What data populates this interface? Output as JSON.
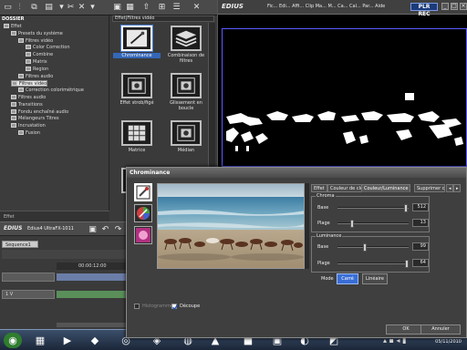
{
  "colors": {
    "accent": "#3467b8",
    "preview_border": "#5a5aff",
    "taskbar": "#1b2638"
  },
  "tree": {
    "header": "DOSSIER",
    "items": [
      {
        "label": "Effet",
        "level": 0
      },
      {
        "label": "Presets du système",
        "level": 1
      },
      {
        "label": "Filtres vidéo",
        "level": 2
      },
      {
        "label": "Color Correction",
        "level": 3
      },
      {
        "label": "Combine",
        "level": 3
      },
      {
        "label": "Matrix",
        "level": 3
      },
      {
        "label": "Region",
        "level": 3
      },
      {
        "label": "Filtres audio",
        "level": 2
      },
      {
        "label": "Filtres vidéo",
        "level": 1,
        "selected": true
      },
      {
        "label": "Correction colorimétrique",
        "level": 2
      },
      {
        "label": "Filtres audio",
        "level": 1
      },
      {
        "label": "Transitions",
        "level": 1
      },
      {
        "label": "Fondu enchaîné audio",
        "level": 1
      },
      {
        "label": "Mélangeurs Titres",
        "level": 1
      },
      {
        "label": "Incrustation",
        "level": 1
      },
      {
        "label": "Fusion",
        "level": 2
      }
    ],
    "footer": "Effet"
  },
  "palette": {
    "path": "Effet|Filtres vidéo",
    "items": [
      {
        "label": "Chrominance",
        "selected": true,
        "icon": "pen-icon"
      },
      {
        "label": "Combinaison de filtres",
        "icon": "stack-icon"
      },
      {
        "label": "Effet strob/figé",
        "icon": "film-icon"
      },
      {
        "label": "Glissement en boucle",
        "icon": "film-icon"
      },
      {
        "label": "Matrice",
        "icon": "grid-icon"
      },
      {
        "label": "Médian",
        "icon": "film-icon"
      },
      {
        "label": "",
        "icon": "grid-icon"
      },
      {
        "label": "",
        "icon": "film-icon"
      }
    ]
  },
  "preview": {
    "logo": "EDIUS",
    "menu": "Fic... Edi... Affi... Clip Ma... M... Ca... Cal... Par... Aide",
    "badge": "PLR REC"
  },
  "timeline": {
    "logo": "EDIUS",
    "project": "Edius4 UltraFX-1011",
    "sequence": "Séquence1",
    "timecode": "00:00:12:00",
    "tracks": [
      "1 V",
      ""
    ]
  },
  "dialog": {
    "title": "Chrominance",
    "tabs": [
      "Effet",
      "Couleur de clef",
      "Couleur/Luminance",
      "Supprimer c"
    ],
    "chroma": {
      "title": "Chroma",
      "base_label": "Base",
      "base_value": "512",
      "base_fraction": 0.96,
      "range_label": "Plage",
      "range_value": "13",
      "range_fraction": 0.2
    },
    "luminance": {
      "title": "Luminance",
      "base_label": "Base",
      "base_value": "99",
      "base_fraction": 0.39,
      "range_label": "Plage",
      "range_value": "64",
      "range_fraction": 0.97
    },
    "mode_label": "Mode",
    "mode_options": [
      "Carré",
      "Linéaire"
    ],
    "mode_selected": "Carré",
    "histogram_label": "Histogramme",
    "histogram_checked": false,
    "cut_label": "Découpe",
    "cut_checked": true,
    "ok_label": "OK",
    "cancel_label": "Annuler"
  },
  "taskbar": {
    "date": "05/11/2010"
  }
}
